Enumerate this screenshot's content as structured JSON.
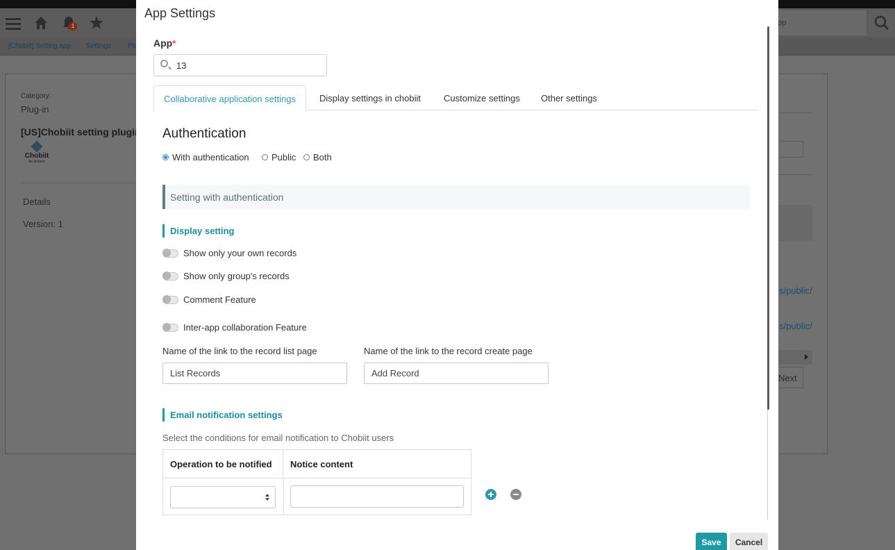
{
  "background": {
    "notification_count": "1",
    "search_text": "pp",
    "breadcrumb": [
      "[Chobiit] Setting app",
      "Settings",
      "Plu"
    ],
    "category_label": "Category:",
    "category_value": "Plug-in",
    "plugin_title": "[US]Chobiit setting plugin",
    "logo_text": "Chobiit",
    "logo_subtext": "for kintone",
    "details_label": "Details",
    "version_label": "Version: 1",
    "link1": "s/public/",
    "link2": "s/public/",
    "next_label": "Next"
  },
  "modal": {
    "title": "App Settings",
    "app_label": "App",
    "app_required_mark": "*",
    "app_value": "13",
    "tabs": [
      {
        "label": "Collaborative application settings",
        "active": true
      },
      {
        "label": "Display settings in chobiit",
        "active": false
      },
      {
        "label": "Customize settings",
        "active": false
      },
      {
        "label": "Other settings",
        "active": false
      }
    ],
    "auth_heading": "Authentication",
    "auth_options": [
      {
        "label": "With authentication",
        "checked": true
      },
      {
        "label": "Public",
        "checked": false
      },
      {
        "label": "Both",
        "checked": false
      }
    ],
    "section_title": "Setting with authentication",
    "display_setting_title": "Display setting",
    "toggles": [
      {
        "label": "Show only your own records",
        "on": false
      },
      {
        "label": "Show only group's records",
        "on": false
      },
      {
        "label": "Comment Feature",
        "on": false
      },
      {
        "label": "Inter-app collaboration Feature",
        "on": false
      }
    ],
    "list_link_label": "Name of the link to the record list page",
    "list_link_value": "List Records",
    "create_link_label": "Name of the link to the record create page",
    "create_link_value": "Add Record",
    "email_title": "Email notification settings",
    "email_desc": "Select the conditions for email notification to Chobiit users",
    "table_headers": [
      "Operation to be notified",
      "Notice content"
    ],
    "save_label": "Save",
    "cancel_label": "Cancel"
  },
  "colors": {
    "accent": "#1f9aa4",
    "tab_active": "#3498a6",
    "radio_checked": "#2d8fd5",
    "required": "#e74c3c"
  }
}
